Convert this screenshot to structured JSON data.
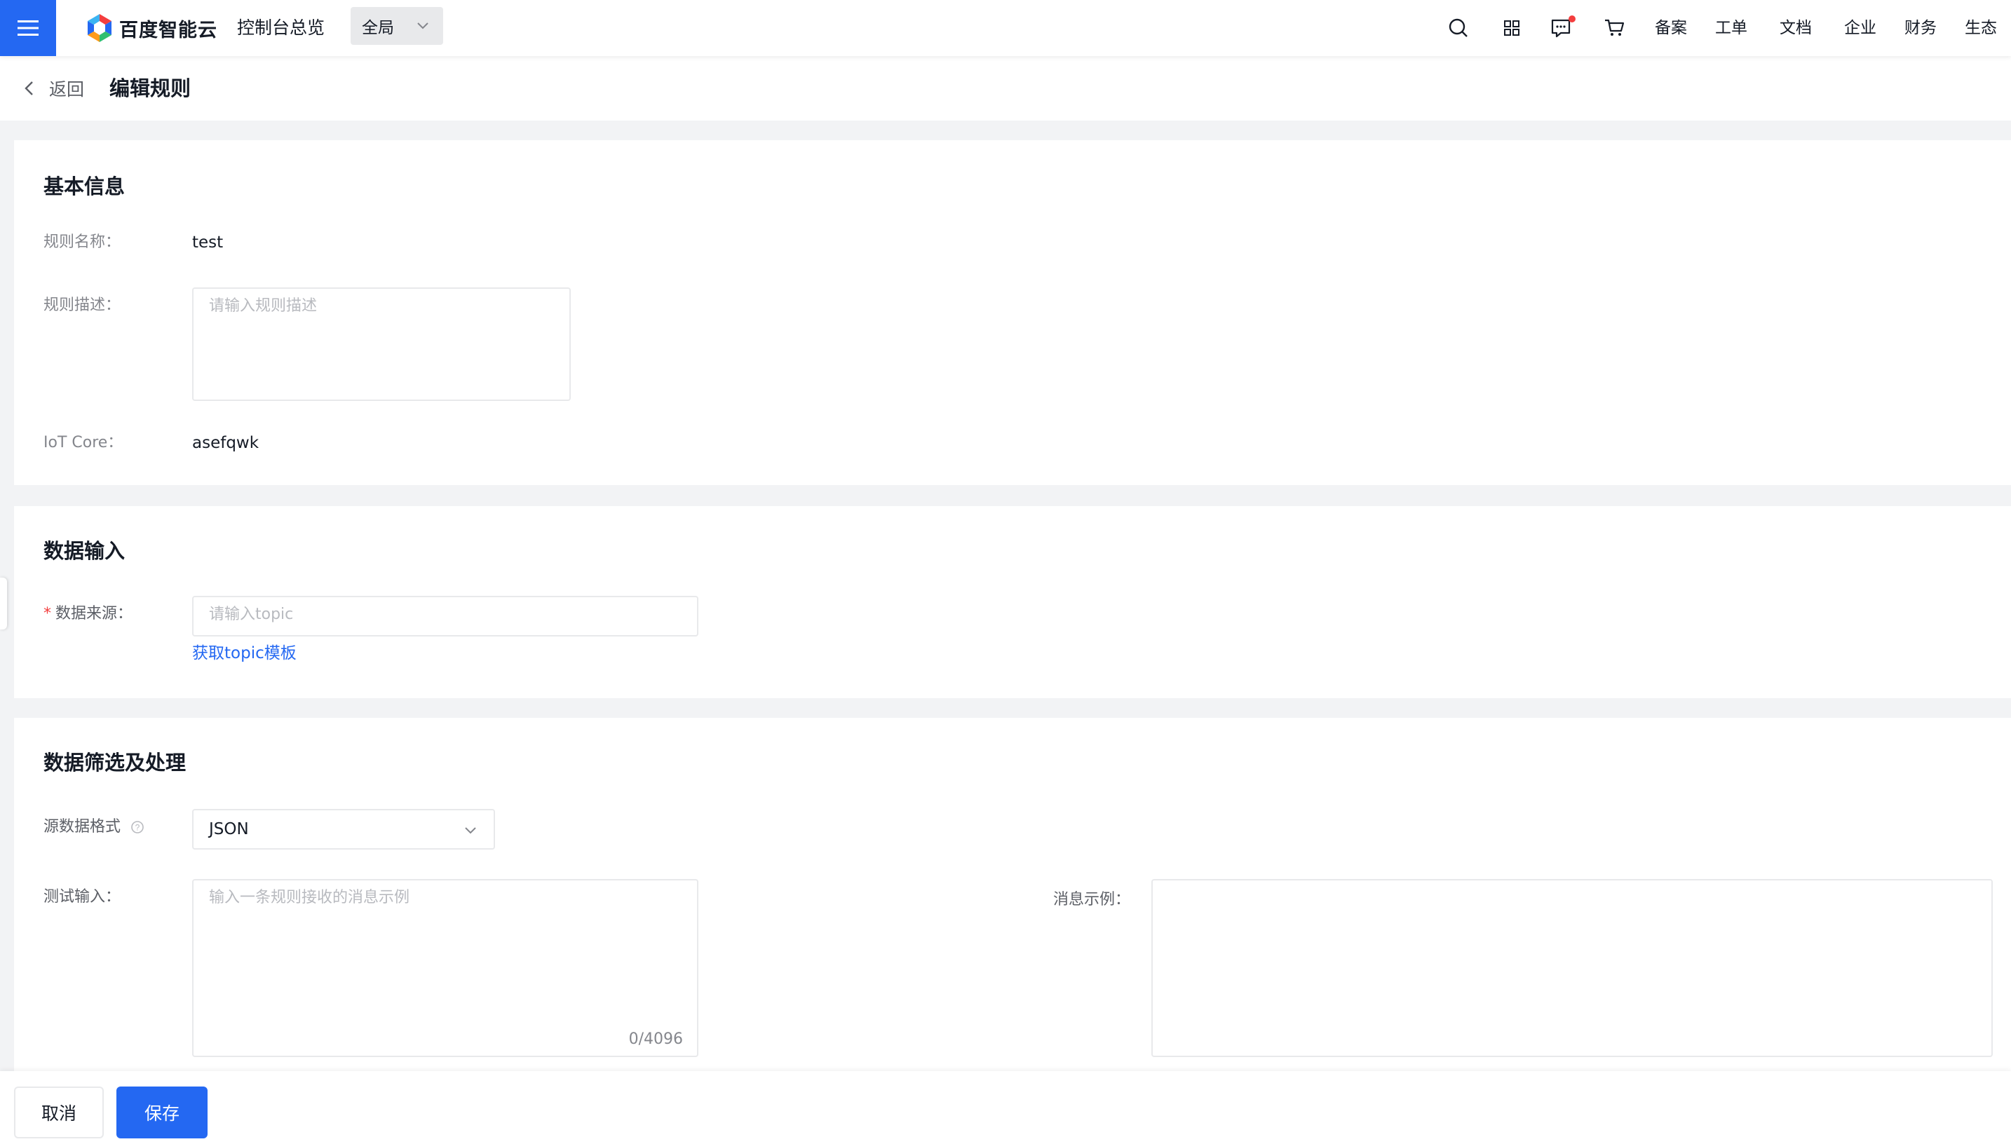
{
  "topbar": {
    "brand": "百度智能云",
    "console_link": "控制台总览",
    "region_selected": "全局",
    "nav": [
      "备案",
      "工单",
      "文档",
      "企业",
      "财务",
      "生态"
    ],
    "icons": [
      "search-icon",
      "app-grid-icon",
      "message-icon",
      "cart-icon"
    ],
    "accent_color": "#2468f2",
    "notification_dot_color": "#f33e3e"
  },
  "header": {
    "back_label": "返回",
    "title": "编辑规则"
  },
  "basic_info": {
    "title": "基本信息",
    "name_label": "规则名称：",
    "name_value": "test",
    "desc_label": "规则描述：",
    "desc_placeholder": "请输入规则描述",
    "iot_label": "IoT Core：",
    "iot_value": "asefqwk"
  },
  "data_input": {
    "title": "数据输入",
    "required_mark": "*",
    "source_label": "数据来源：",
    "source_placeholder": "请输入topic",
    "template_link": "获取topic模板"
  },
  "data_filter": {
    "title": "数据筛选及处理",
    "format_label": "源数据格式",
    "format_value": "JSON",
    "test_label": "测试输入：",
    "test_placeholder": "输入一条规则接收的消息示例",
    "counter": "0/4096",
    "example_label": "消息示例："
  },
  "footer": {
    "cancel_label": "取消",
    "save_label": "保存"
  }
}
